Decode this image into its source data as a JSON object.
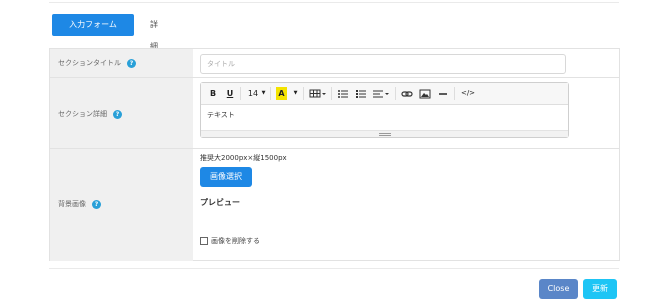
{
  "tabs": {
    "active": "入力フォーム",
    "inactive": "詳細設定"
  },
  "form": {
    "section_title": {
      "label": "セクションタイトル",
      "help": "?",
      "placeholder": "タイトル"
    },
    "section_detail": {
      "label": "セクション詳細",
      "help": "?",
      "toolbar": {
        "bold": "B",
        "underline": "U",
        "font_size": "14",
        "font_color": "A",
        "code": "</>"
      },
      "content": "テキスト"
    },
    "background_image": {
      "label": "背景画像",
      "help": "?",
      "size_note": "推奨大2000px×縦1500px",
      "select_button": "画像選択",
      "preview_label": "プレビュー",
      "delete_label": "画像を削除する"
    }
  },
  "footer": {
    "close_label": "Close",
    "update_label": "更新"
  },
  "colors": {
    "primary": "#1e88e5",
    "close": "#5a86c8",
    "update": "#1ec5f5",
    "help": "#29a0d8"
  }
}
